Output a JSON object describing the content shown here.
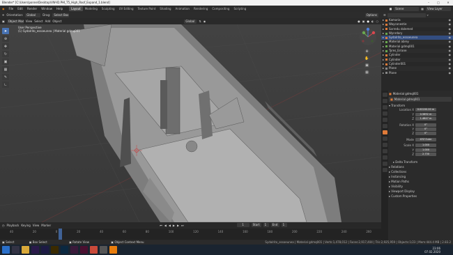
{
  "window": {
    "title": "Blender* [C:\\Users\\ponne\\Desktop\\VW-ID.PHI_T5_High_Roof_Expand_1.blend]"
  },
  "menu": [
    "File",
    "Edit",
    "Render",
    "Window",
    "Help"
  ],
  "workspaces": [
    "Layout",
    "Modeling",
    "Sculpting",
    "UV Editing",
    "Texture Paint",
    "Shading",
    "Animation",
    "Rendering",
    "Compositing",
    "Scripting"
  ],
  "active_workspace": "Layout",
  "toolbar": {
    "orientation_label": "Orientation:",
    "orientation": "Global",
    "drag_label": "Drag:",
    "drag": "Select Box",
    "options": "Options",
    "transform": "Global"
  },
  "scene": {
    "label": "Scene",
    "view_layer": "View Layer"
  },
  "viewport_header": {
    "mode": "Object Mode",
    "items": [
      "View",
      "Select",
      "Add",
      "Object"
    ]
  },
  "viewport_info": {
    "line1": "User Perspective",
    "line2": "(1) Sydalrito_essoeunea | Material gdmq001"
  },
  "outliner": {
    "rows": [
      {
        "name": "Kamaria",
        "color": "#e07b39"
      },
      {
        "name": "Wayconestie",
        "color": "#e07b39"
      },
      {
        "name": "Sorredu dolemed",
        "color": "#e07b39"
      },
      {
        "name": "Wynrdary",
        "color": "#6aa84f"
      },
      {
        "name": "Sydalrito_essoeunea",
        "color": "#e07b39"
      },
      {
        "name": "Material abrey",
        "color": "#6aa84f"
      },
      {
        "name": "Material gdmq001",
        "color": "#6aa84f"
      },
      {
        "name": "Tyres_Errane",
        "color": "#6aa84f"
      },
      {
        "name": "Cylinder",
        "color": "#e07b39"
      },
      {
        "name": "Cylinder",
        "color": "#e07b39"
      },
      {
        "name": "Cylinder001",
        "color": "#e07b39"
      },
      {
        "name": "Plane",
        "color": "#888888"
      },
      {
        "name": "Plane",
        "color": "#888888"
      }
    ],
    "selected_index": 4
  },
  "properties": {
    "object_name": "Material gdmq001",
    "data_name": "Material gdmq001",
    "transform_label": "Transform",
    "location_label": "Location X",
    "rotation_label": "Rotation X",
    "mode_label": "Mode",
    "scale_label": "Scale X",
    "location": [
      "0.00200.00 m",
      "0.5892 m",
      "1.4847 m"
    ],
    "rotation": [
      "0°",
      "0°",
      "0°"
    ],
    "mode": "XYZ Euler",
    "scale": [
      "1.000",
      "1.000",
      "2.730"
    ],
    "sections": [
      "Delta Transform",
      "Relations",
      "Collections",
      "Instancing",
      "Motion Paths",
      "Visibility",
      "Viewport Display",
      "Custom Properties"
    ]
  },
  "timeline": {
    "menus": [
      "Playback",
      "Keying",
      "View",
      "Marker"
    ],
    "current_frame": "1",
    "start_label": "Start",
    "start": "1",
    "end_label": "End",
    "end": "1",
    "ticks": [
      "40",
      "20",
      "0",
      "20",
      "40",
      "60",
      "80",
      "100",
      "120",
      "140",
      "160",
      "180",
      "200",
      "220",
      "240",
      "260"
    ]
  },
  "statusbar": {
    "left": [
      "Select",
      "Box Select",
      "Rotate View",
      "Object Context Menu"
    ],
    "right": "Sydalrito_essoeunea | Material gdmq001 | Verts:1,478,012 | Faces:2,917,404 | Tris:2,925,959 | Objects:1/23 | Mem:444.4 MB | 2.83.2"
  },
  "taskbar": {
    "time": "23:06",
    "date": "07.02.2020"
  },
  "colors": {
    "accent": "#4772b3",
    "viewport": "#3d3d3d"
  }
}
